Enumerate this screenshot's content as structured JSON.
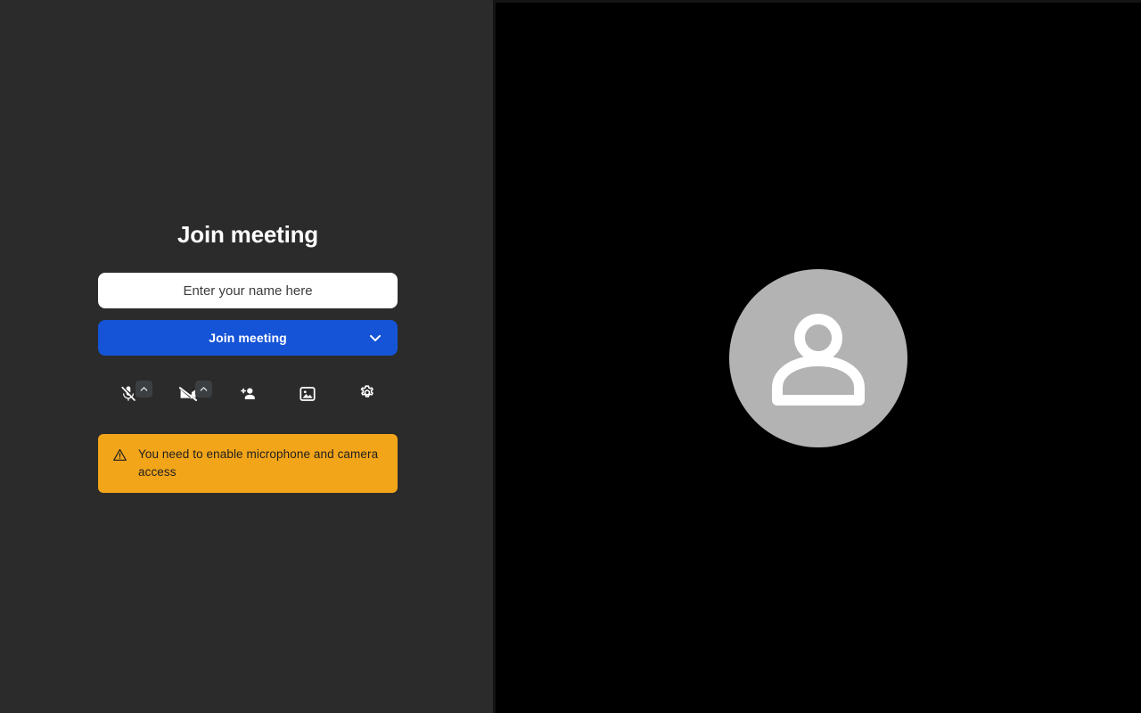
{
  "panel": {
    "title": "Join meeting"
  },
  "name_input": {
    "placeholder": "Enter your name here",
    "value": ""
  },
  "join_button": {
    "label": "Join meeting",
    "options_icon": "chevron-down-icon",
    "color": "#1554d6"
  },
  "toolbar": {
    "items": [
      {
        "name": "microphone-muted-icon",
        "label": "Microphone",
        "state": "muted",
        "has_expander": true,
        "expander_icon": "chevron-up-icon"
      },
      {
        "name": "camera-off-icon",
        "label": "Camera",
        "state": "off",
        "has_expander": true,
        "expander_icon": "chevron-up-icon"
      },
      {
        "name": "invite-person-icon",
        "label": "Invite people",
        "state": "default",
        "has_expander": false,
        "expander_icon": ""
      },
      {
        "name": "virtual-background-icon",
        "label": "Select background",
        "state": "default",
        "has_expander": false,
        "expander_icon": ""
      },
      {
        "name": "settings-gear-icon",
        "label": "Settings",
        "state": "default",
        "has_expander": false,
        "expander_icon": ""
      }
    ]
  },
  "warning": {
    "icon": "warning-triangle-icon",
    "text": "You need to enable microphone and camera access",
    "background_color": "#f3a51a",
    "text_color": "#1f1f1f"
  },
  "video_preview": {
    "avatar_icon": "person-avatar-icon",
    "background_color": "#000000",
    "avatar_color": "#b3b3b3"
  }
}
